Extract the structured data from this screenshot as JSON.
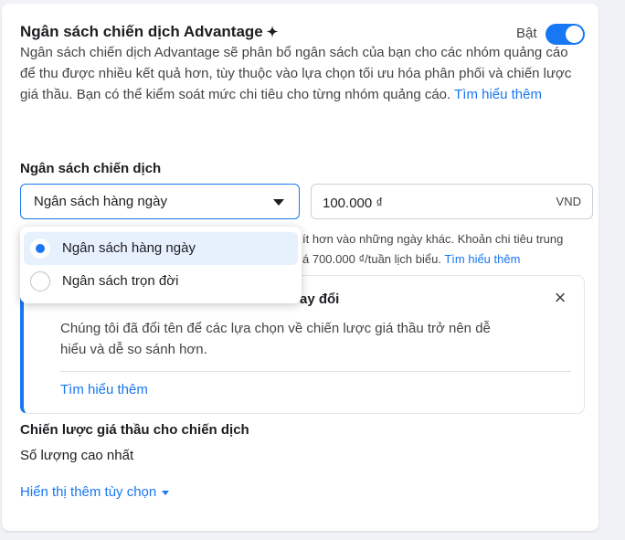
{
  "header": {
    "title": "Ngân sách chiến dịch Advantage",
    "title_icon": "✦",
    "toggle_label": "Bật",
    "toggle_on": true
  },
  "description": {
    "text": "Ngân sách chiến dịch Advantage sẽ phân bổ ngân sách của bạn cho các nhóm quảng cáo để thu được nhiều kết quả hơn, tùy thuộc vào lựa chọn tối ưu hóa phân phối và chiến lược giá thầu. Bạn có thể kiểm soát mức chi tiêu cho từng nhóm quảng cáo.",
    "link": "Tìm hiểu thêm"
  },
  "budget": {
    "label": "Ngân sách chiến dịch",
    "type_selected": "Ngân sách hàng ngày",
    "amount": "100.000 ₫",
    "currency": "VND"
  },
  "help": {
    "line1": "ít hơn vào những ngày khác. Khoản chi tiêu trung",
    "line2": "á 700.000 ₫/tuần lịch biểu.",
    "link": "Tìm hiểu thêm"
  },
  "dropdown": {
    "options": [
      {
        "label": "Ngân sách hàng ngày",
        "selected": true
      },
      {
        "label": "Ngân sách trọn đời",
        "selected": false
      }
    ]
  },
  "info": {
    "title_visible": "ay đổi",
    "body": "Chúng tôi đã đổi tên để các lựa chọn về chiến lược giá thầu trở nên dễ hiểu và dễ so sánh hơn.",
    "link": "Tìm hiểu thêm",
    "close_icon": "×"
  },
  "strategy": {
    "label": "Chiến lược giá thầu cho chiến dịch",
    "value": "Số lượng cao nhất"
  },
  "more_options": "Hiển thị thêm tùy chọn",
  "colors": {
    "accent": "#1877f2",
    "selected_bg": "#e7f0fd"
  }
}
